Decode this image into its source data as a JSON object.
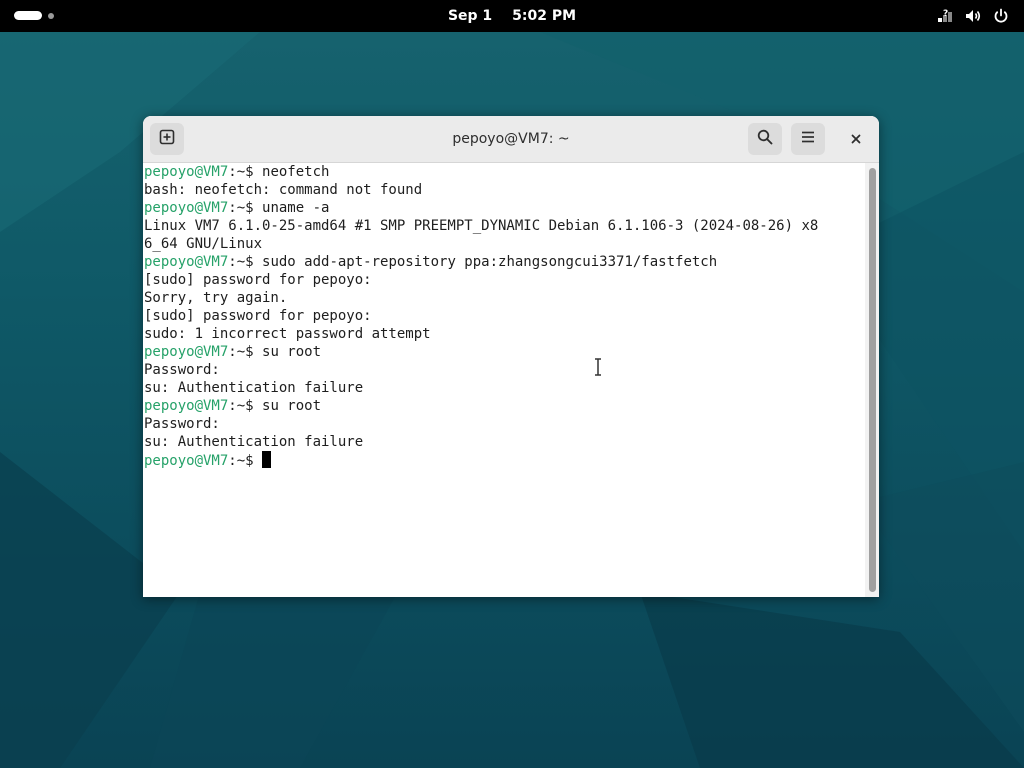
{
  "topbar": {
    "date": "Sep 1",
    "time": "5:02 PM",
    "tray_icons": [
      "network-unknown-icon",
      "volume-icon",
      "power-icon"
    ]
  },
  "window": {
    "title": "pepoyo@VM7: ~",
    "buttons": [
      "new-tab-icon",
      "search-icon",
      "hamburger-menu-icon",
      "close-icon"
    ]
  },
  "terminal": {
    "prompt": "pepoyo@VM7",
    "prompt_suffix": ":~$ ",
    "lines": [
      {
        "type": "cmd",
        "text": "neofetch"
      },
      {
        "type": "out",
        "text": "bash: neofetch: command not found"
      },
      {
        "type": "cmd",
        "text": "uname -a"
      },
      {
        "type": "out",
        "text": "Linux VM7 6.1.0-25-amd64 #1 SMP PREEMPT_DYNAMIC Debian 6.1.106-3 (2024-08-26) x8"
      },
      {
        "type": "out",
        "text": "6_64 GNU/Linux"
      },
      {
        "type": "cmd",
        "text": "sudo add-apt-repository ppa:zhangsongcui3371/fastfetch"
      },
      {
        "type": "out",
        "text": "[sudo] password for pepoyo:"
      },
      {
        "type": "out",
        "text": "Sorry, try again."
      },
      {
        "type": "out",
        "text": "[sudo] password for pepoyo:"
      },
      {
        "type": "out",
        "text": "sudo: 1 incorrect password attempt"
      },
      {
        "type": "cmd",
        "text": "su root"
      },
      {
        "type": "out",
        "text": "Password:"
      },
      {
        "type": "out",
        "text": "su: Authentication failure"
      },
      {
        "type": "cmd",
        "text": "su root"
      },
      {
        "type": "out",
        "text": "Password:"
      },
      {
        "type": "out",
        "text": "su: Authentication failure"
      },
      {
        "type": "cmd",
        "text": ""
      }
    ]
  },
  "colors": {
    "prompt": "#26a269",
    "topbar": "#000000",
    "titlebar": "#ebebeb",
    "wallpaper": "#0f5967"
  }
}
